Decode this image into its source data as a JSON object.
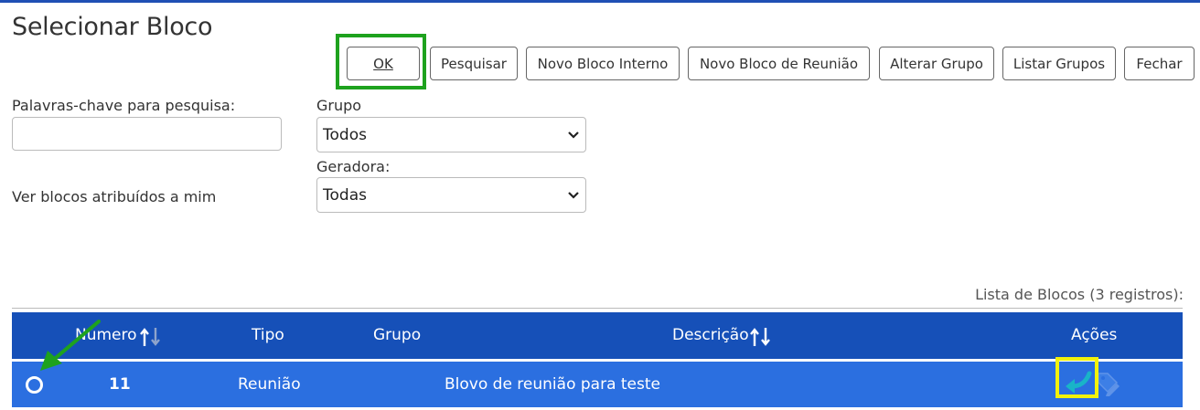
{
  "page": {
    "title": "Selecionar Bloco"
  },
  "toolbar": {
    "ok_label": "OK",
    "search_label": "Pesquisar",
    "new_internal_label": "Novo Bloco Interno",
    "new_meeting_label": "Novo Bloco de Reunião",
    "change_group_label": "Alterar Grupo",
    "list_groups_label": "Listar Grupos",
    "close_label": "Fechar"
  },
  "filters": {
    "keywords_label": "Palavras-chave para pesquisa:",
    "keywords_value": "",
    "group_label": "Grupo",
    "group_value": "Todos",
    "generator_label": "Geradora:",
    "generator_value": "Todas",
    "assigned_label": "Ver blocos atribuídos a mim"
  },
  "table": {
    "caption": "Lista de Blocos (3 registros):",
    "headers": {
      "numero": "Número",
      "tipo": "Tipo",
      "grupo": "Grupo",
      "descricao": "Descrição",
      "acoes": "Ações"
    },
    "rows": [
      {
        "numero": "11",
        "tipo": "Reunião",
        "grupo": "",
        "descricao": "Blovo de reunião para teste",
        "action_icons": [
          "return-arrow-icon",
          "tag-edit-icon"
        ]
      }
    ]
  },
  "colors": {
    "header_bg": "#1650b8",
    "row_selected_bg": "#2b6fe0",
    "highlight_green": "#1ea21e",
    "highlight_yellow": "#f2f20a",
    "action_icon_teal": "#19b4c8"
  }
}
